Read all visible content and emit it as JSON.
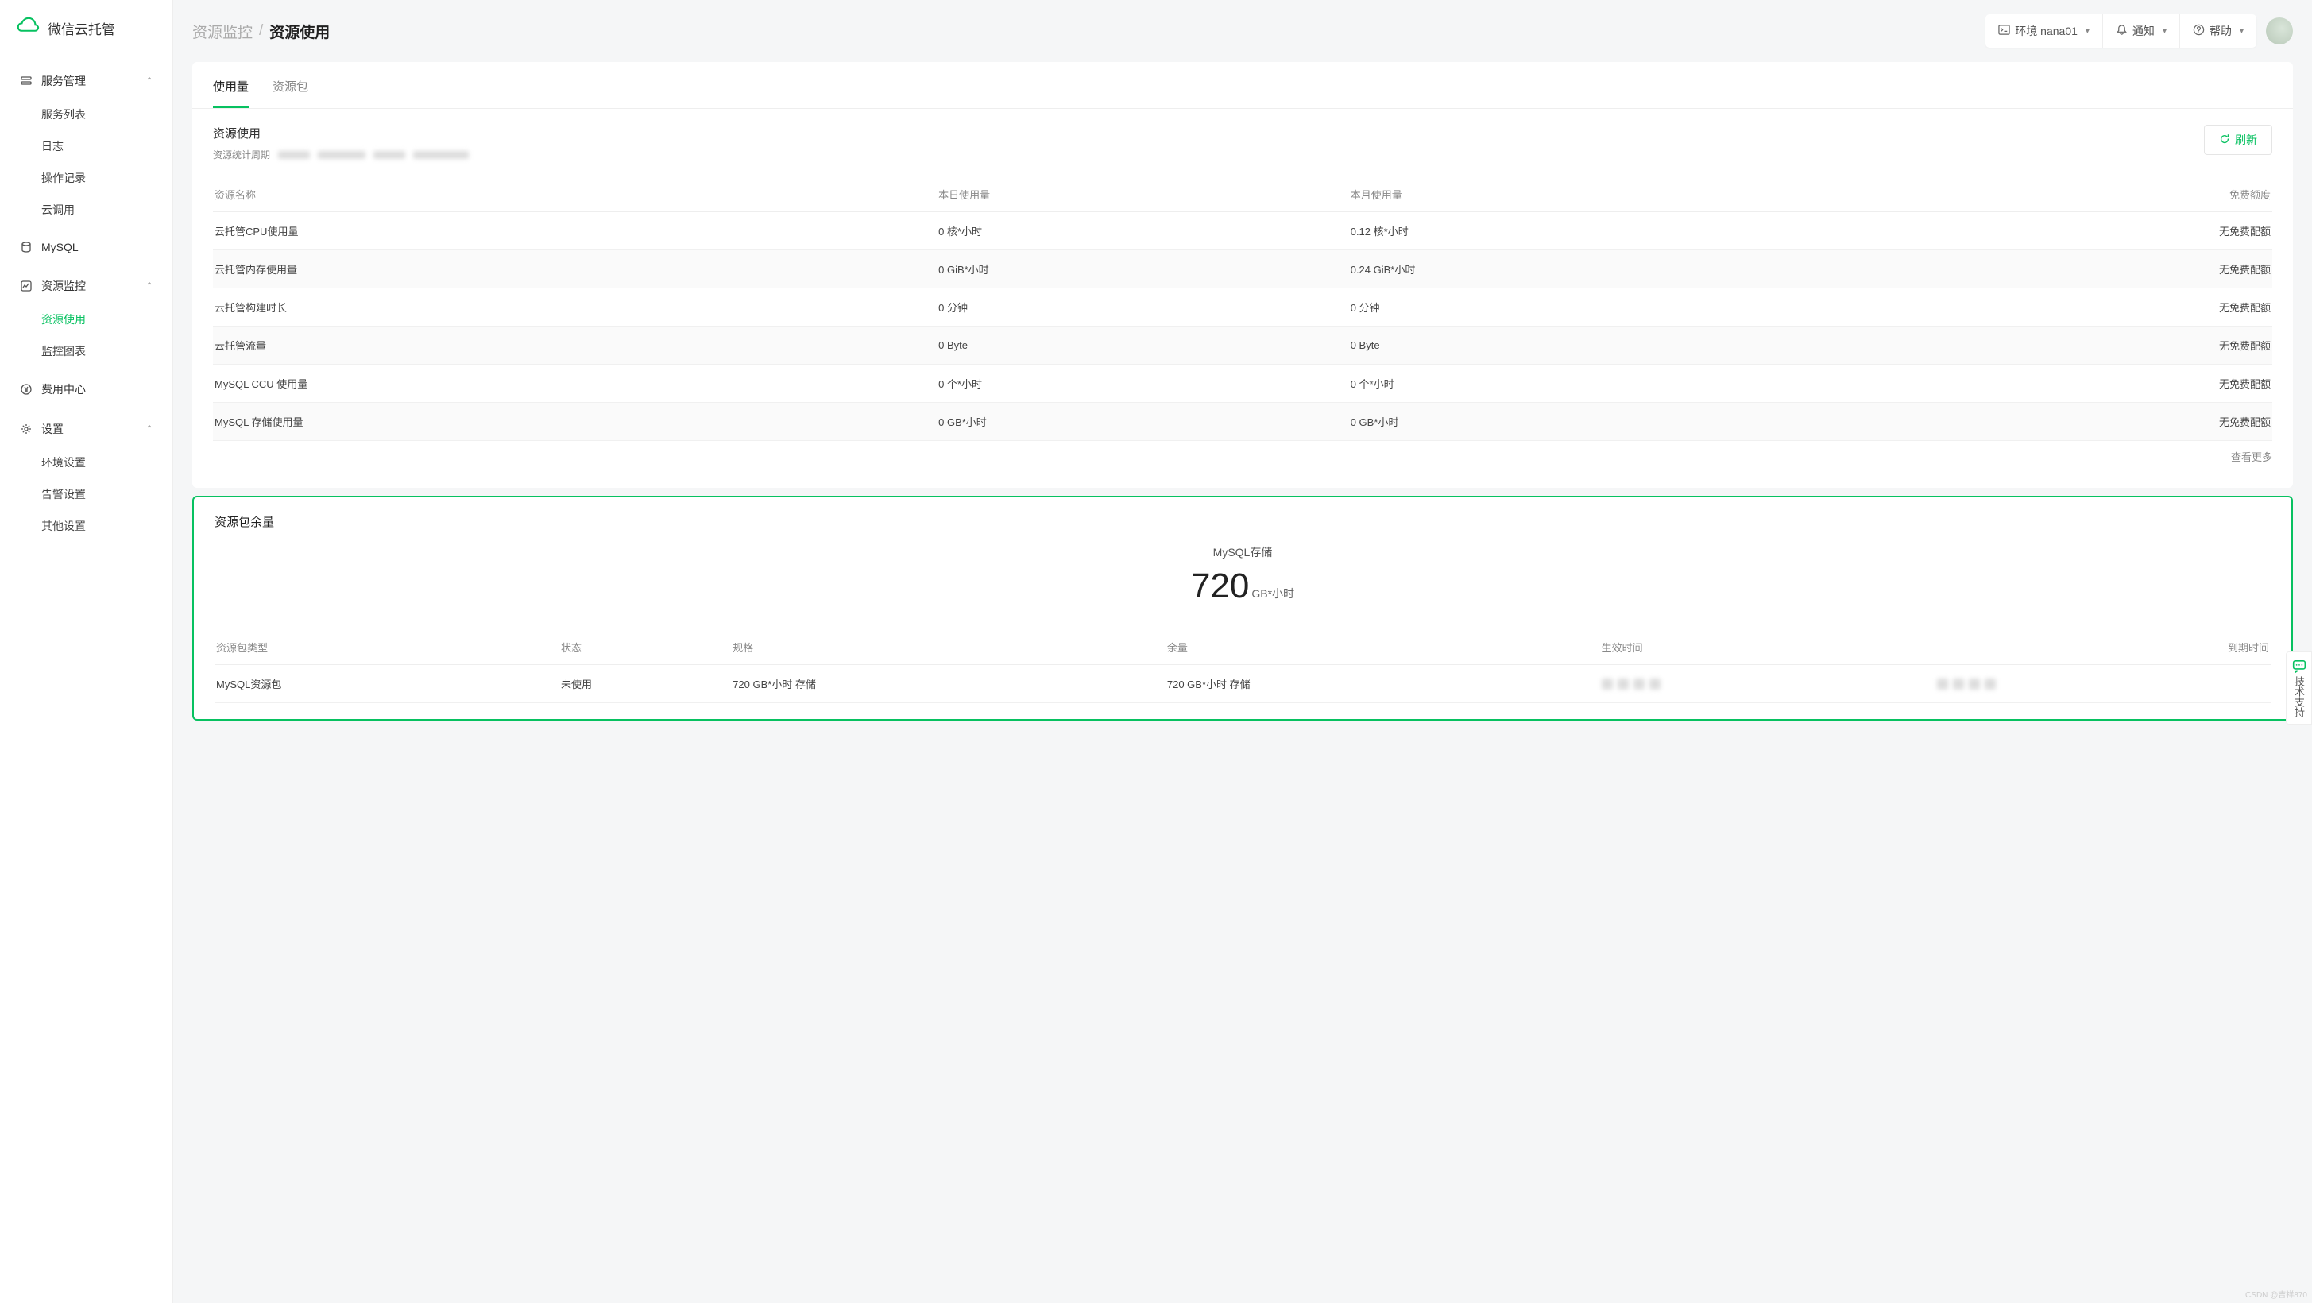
{
  "brand": "微信云托管",
  "sidebar": {
    "groups": [
      {
        "label": "服务管理",
        "items": [
          "服务列表",
          "日志",
          "操作记录",
          "云调用"
        ],
        "expanded": true
      },
      {
        "label": "MySQL",
        "items": [],
        "expanded": false
      },
      {
        "label": "资源监控",
        "items": [
          "资源使用",
          "监控图表"
        ],
        "expanded": true,
        "activeIndex": 0
      },
      {
        "label": "费用中心",
        "items": [],
        "expanded": false
      },
      {
        "label": "设置",
        "items": [
          "环境设置",
          "告警设置",
          "其他设置"
        ],
        "expanded": true
      }
    ]
  },
  "breadcrumb": {
    "parent": "资源监控",
    "current": "资源使用"
  },
  "topbar": {
    "env_label": "环境 nana01",
    "notify": "通知",
    "help": "帮助"
  },
  "tabs": [
    {
      "label": "使用量",
      "active": true
    },
    {
      "label": "资源包",
      "active": false
    }
  ],
  "section": {
    "title": "资源使用",
    "period_label": "资源统计周期",
    "refresh": "刷新",
    "see_more": "查看更多"
  },
  "table": {
    "columns": [
      "资源名称",
      "本日使用量",
      "本月使用量",
      "免费额度"
    ],
    "rows": [
      [
        "云托管CPU使用量",
        "0 核*小时",
        "0.12 核*小时",
        "无免费配额"
      ],
      [
        "云托管内存使用量",
        "0 GiB*小时",
        "0.24 GiB*小时",
        "无免费配额"
      ],
      [
        "云托管构建时长",
        "0 分钟",
        "0 分钟",
        "无免费配额"
      ],
      [
        "云托管流量",
        "0 Byte",
        "0 Byte",
        "无免费配额"
      ],
      [
        "MySQL CCU 使用量",
        "0 个*小时",
        "0 个*小时",
        "无免费配额"
      ],
      [
        "MySQL 存储使用量",
        "0 GB*小时",
        "0 GB*小时",
        "无免费配额"
      ]
    ]
  },
  "card": {
    "title": "资源包余量",
    "big_metric": {
      "label": "MySQL存储",
      "value": "720",
      "unit": "GB*小时"
    },
    "columns": [
      "资源包类型",
      "状态",
      "规格",
      "余量",
      "生效时间",
      "到期时间"
    ],
    "row": [
      "MySQL资源包",
      "未使用",
      "720 GB*小时 存储",
      "720 GB*小时 存储"
    ]
  },
  "support": "技术支持",
  "watermark": "CSDN @吉祥870"
}
